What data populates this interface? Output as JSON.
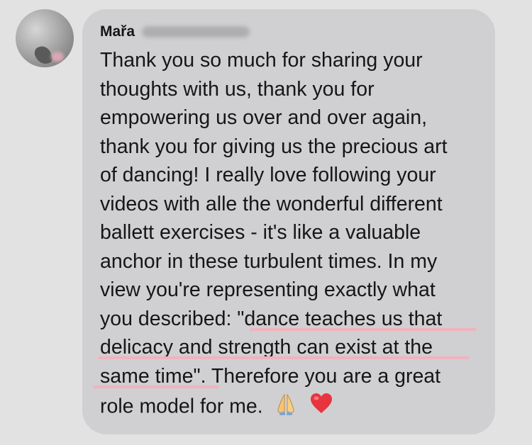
{
  "comment": {
    "author": "Mařa",
    "lines": [
      "Thank you so much for sharing your",
      "thoughts with us, thank you for",
      "empowering us over and over again,",
      "thank you for giving us the precious art",
      "of dancing! I really love following your",
      "videos with alle the wonderful different",
      "ballett exercises - it's like a valuable",
      "anchor in these turbulent times. In my",
      "view you're representing exactly what",
      "you described: \"dance teaches us that",
      "delicacy and strength can exist at the",
      "same time\". Therefore you are a great",
      "role model for me."
    ],
    "emojis": [
      "praying-hands-icon",
      "red-heart-icon"
    ],
    "highlight_color": "#f0b3be",
    "bubble_color": "#d0d0d2",
    "background_color": "#e2e2e2"
  }
}
